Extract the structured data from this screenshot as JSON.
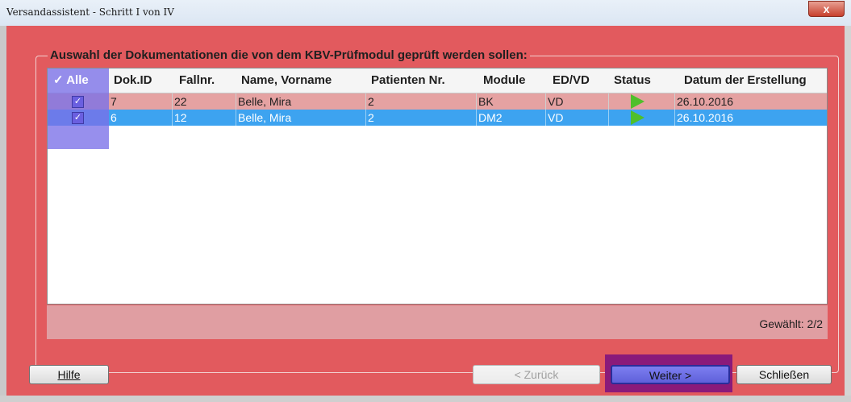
{
  "window": {
    "title": "Versandassistent - Schritt I von IV",
    "close_label": "x"
  },
  "group": {
    "title": "Auswahl der Dokumentationen die von dem KBV-Prüfmodul geprüft werden sollen:"
  },
  "table": {
    "select_all": {
      "label": "Alle",
      "checked": true
    },
    "columns": [
      "Dok.ID",
      "Fallnr.",
      "Name, Vorname",
      "Patienten Nr.",
      "Module",
      "ED/VD",
      "Status",
      "Datum der Erstellung"
    ],
    "rows": [
      {
        "checked": true,
        "dok_id": "7",
        "fallnr": "22",
        "name": "Belle, Mira",
        "patienten_nr": "2",
        "module": "BK",
        "ed_vd": "VD",
        "status": "play-icon",
        "datum": "26.10.2016",
        "selected": false
      },
      {
        "checked": true,
        "dok_id": "6",
        "fallnr": "12",
        "name": "Belle, Mira",
        "patienten_nr": "2",
        "module": "DM2",
        "ed_vd": "VD",
        "status": "play-icon",
        "datum": "26.10.2016",
        "selected": true
      }
    ]
  },
  "footer": {
    "selected_count": "Gewählt: 2/2"
  },
  "buttons": {
    "help": "Hilfe",
    "back": "< Zurück",
    "next": "Weiter >",
    "close": "Schließen"
  },
  "colors": {
    "window_bg": "#e25a5e",
    "row_selected": "#3da3f0",
    "row_normal": "#e5a2a2",
    "status_green": "#4fbf2a"
  }
}
